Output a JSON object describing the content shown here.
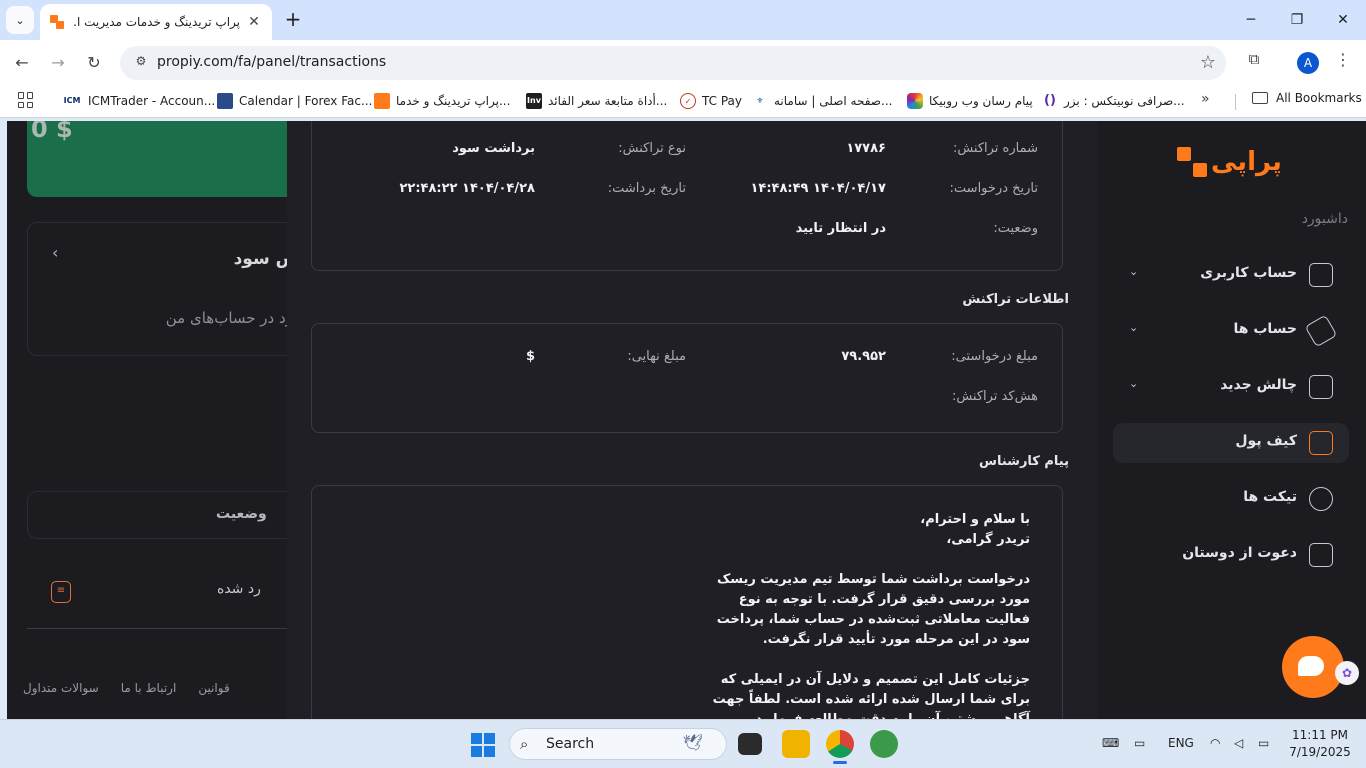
{
  "browser": {
    "tab_title": "پراپ تریدینگ و خدمات مدیریت ا...",
    "url": "propiy.com/fa/panel/transactions",
    "profile_initial": "A",
    "bookmarks": [
      {
        "label": "ICMTrader - Accoun...",
        "icon": "ICM"
      },
      {
        "label": "Calendar | Forex Fac...",
        "icon": "forexfactory-icon"
      },
      {
        "label": "پراپ تریدینگ و خدما...",
        "icon": "propiy-icon"
      },
      {
        "label": "أداة متابعة سعر الفائد...",
        "icon": "Inv"
      },
      {
        "label": "TC Pay",
        "icon": "tcpay-icon"
      },
      {
        "label": "صفحه اصلی | سامانه...",
        "icon": "emblem-icon"
      },
      {
        "label": "پیام رسان وب روبیکا",
        "icon": "rubika-icon"
      },
      {
        "label": "صرافی نوبیتکس : بزر...",
        "icon": "nobitex-icon"
      }
    ],
    "all_bookmarks": "All Bookmarks"
  },
  "sidebar": {
    "logo_text": "پراپی",
    "dashboard_label": "داشبورد",
    "items": [
      {
        "label": "حساب کاربری",
        "has_chevron": true
      },
      {
        "label": "حساب ها",
        "has_chevron": true
      },
      {
        "label": "چالش جدید",
        "has_chevron": true
      },
      {
        "label": "کیف پول",
        "active": true
      },
      {
        "label": "تیکت ها"
      },
      {
        "label": "دعوت از دوستان"
      }
    ]
  },
  "background": {
    "balance": "0 $",
    "profit_title": "یش سود",
    "profit_subtitle": "سود در حساب‌های من",
    "table_status_header": "وضعیت",
    "row_status": "رد شده",
    "footer_links": [
      "قوانین",
      "ارتباط با ما",
      "سوالات متداول"
    ]
  },
  "transaction": {
    "number_label": "شماره تراکنش:",
    "number_value": "۱۷۷۸۶",
    "type_label": "نوع تراکنش:",
    "type_value": "برداشت سود",
    "request_date_label": "تاریخ درخواست:",
    "request_date_value": "۱۴۰۴/۰۴/۱۷ ۱۴:۴۸:۴۹",
    "withdraw_date_label": "تاریخ برداشت:",
    "withdraw_date_value": "۱۴۰۴/۰۴/۲۸ ۲۲:۴۸:۲۲",
    "status_label": "وضعیت:",
    "status_value": "در انتظار تایید"
  },
  "info": {
    "section_title": "اطلاعات تراکنش",
    "requested_label": "مبلغ درخواستی:",
    "requested_value": "۷۹.۹۵۲",
    "final_label": "مبلغ نهایی:",
    "final_value": "$",
    "hash_label": "هش‌کد تراکنش:"
  },
  "expert": {
    "section_title": "پیام کارشناس",
    "greeting_1": "با سلام و احترام،",
    "greeting_2": "تریدر گرامی،",
    "paragraph_1": "درخواست برداشت شما توسط تیم مدیریت ریسک مورد بررسی دقیق قرار گرفت. با توجه به نوع فعالیت معاملاتی ثبت‌شده در حساب شما، پرداخت سود در این مرحله مورد تأیید قرار نگرفت.",
    "paragraph_2": "جزئیات کامل این تصمیم و دلایل آن در ایمیلی که برای شما ارسال شده ارائه شده است. لطفاً جهت آگاهی بیشتر، آن را به دقت مطالعه فرمایید."
  },
  "taskbar": {
    "search_placeholder": "Search",
    "language": "ENG",
    "time": "11:11 PM",
    "date": "7/19/2025"
  },
  "colors": {
    "accent": "#ff7a1a",
    "page_bg": "#1e1e24",
    "card_green": "#1b6e4a"
  }
}
